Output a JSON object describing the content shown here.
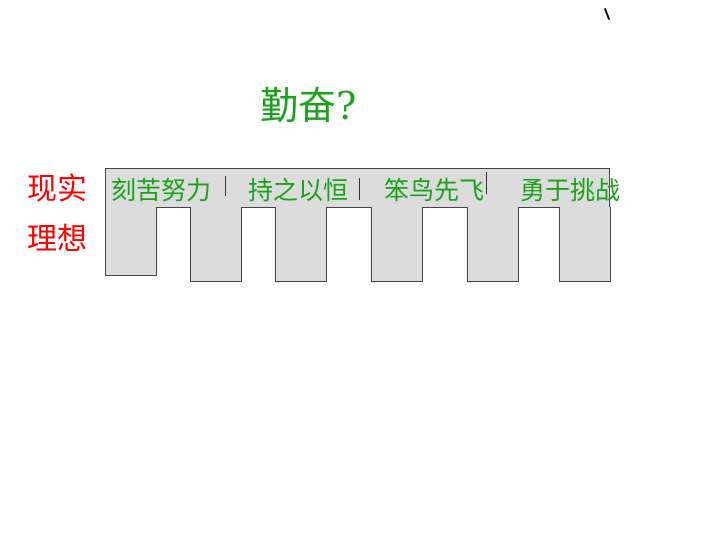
{
  "title": "勤奋?",
  "labels": {
    "reality": "现实",
    "ideal": "理想"
  },
  "phrases": [
    "刻苦努力",
    "持之以恒",
    "笨鸟先飞",
    "勇于挑战"
  ],
  "colors": {
    "title": "#1aa31a",
    "phrases": "#1aa31a",
    "labels": "#ff0000",
    "comb_fill": "#dcdcdc",
    "comb_border": "#444444"
  }
}
